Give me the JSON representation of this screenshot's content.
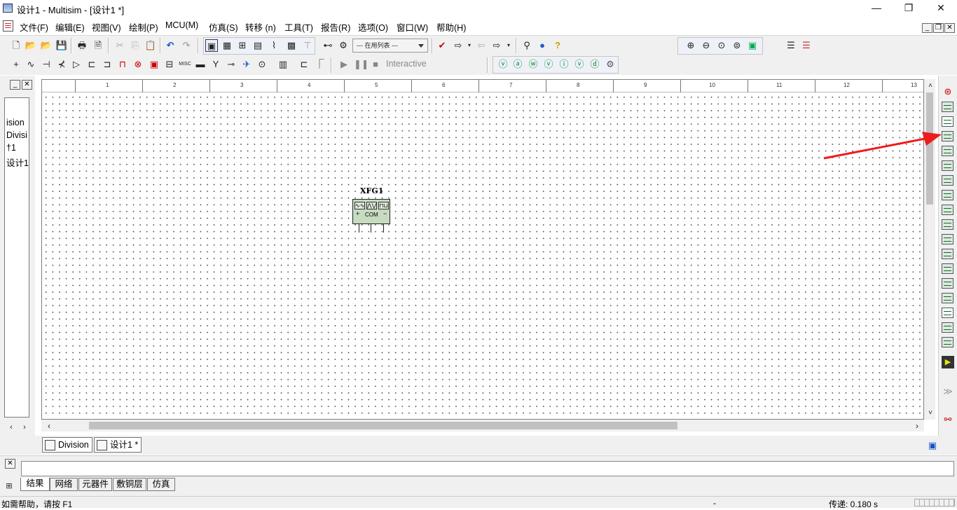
{
  "window": {
    "title": "设计1 - Multisim - [设计1 *]",
    "minimize": "—",
    "restore": "❐",
    "close": "✕"
  },
  "menu": {
    "items": [
      "文件(F)",
      "编辑(E)",
      "视图(V)",
      "绘制(P)",
      "MCU(M)",
      "仿真(S)",
      "转移 (n)",
      "工具(T)",
      "报告(R)",
      "选项(O)",
      "窗口(W)",
      "帮助(H)"
    ]
  },
  "mdi": {
    "minimize": "_",
    "restore": "❐",
    "close": "✕"
  },
  "toolbar": {
    "in_use_list": "--- 在用列表 ---",
    "interactive": "Interactive"
  },
  "left_panel": {
    "lines": [
      "ision",
      "Divisi",
      "†1",
      "设计1"
    ]
  },
  "ruler": {
    "labels": [
      "1",
      "2",
      "3",
      "4",
      "5",
      "6",
      "7",
      "8",
      "9",
      "10",
      "11",
      "12",
      "13"
    ]
  },
  "component": {
    "ref": "XFG1",
    "com": "COM",
    "plus": "+",
    "minus": "−"
  },
  "doc_tabs": [
    "Division",
    "设计1 *"
  ],
  "bottom_tabs": [
    "结果",
    "网络",
    "元器件",
    "敷铜层",
    "仿真"
  ],
  "status": {
    "help": "如需帮助，请按 F1",
    "dash": "-",
    "transfer": "传递: 0.180 s"
  },
  "colors": {
    "arrow": "#ee1c1c",
    "component_body": "#c7dbc0",
    "instrument_green": "#0a6e2a"
  }
}
